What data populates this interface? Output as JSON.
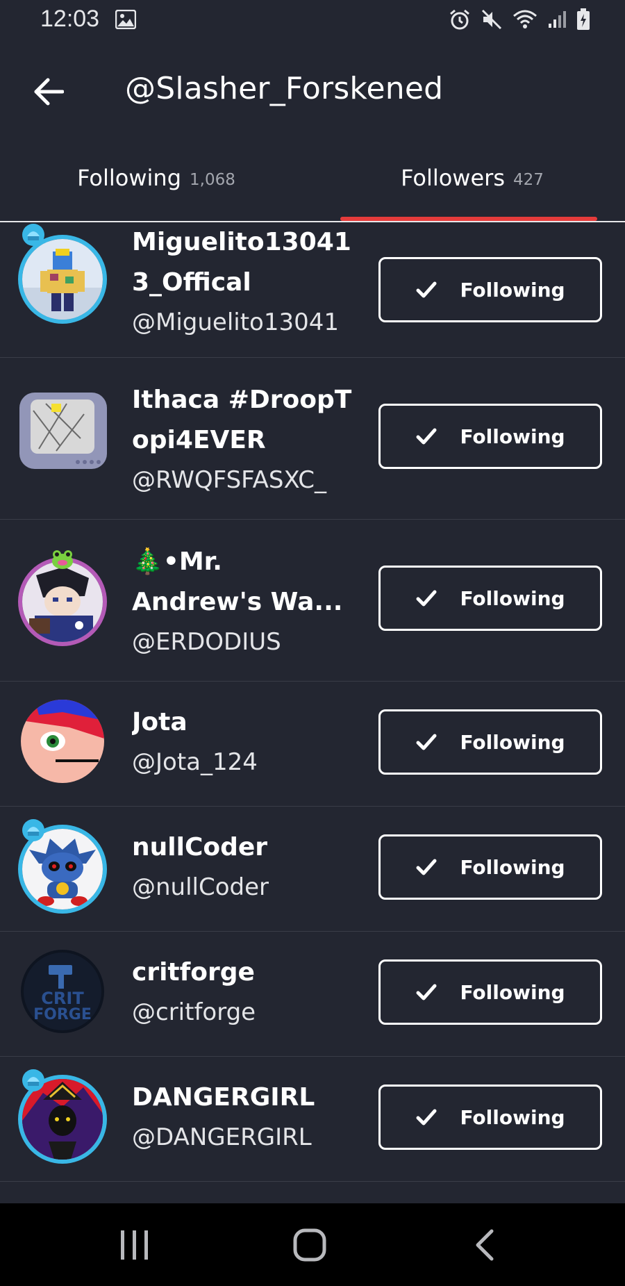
{
  "status_bar": {
    "time": "12:03"
  },
  "app_bar": {
    "title": "@Slasher_Forskened"
  },
  "tabs": [
    {
      "label": "Following",
      "count": "1,068",
      "active": false
    },
    {
      "label": "Followers",
      "count": "427",
      "active": true
    }
  ],
  "accent_color": "#e53b3b",
  "background_color": "#232631",
  "followers": [
    {
      "display_name_line1": "Miguelito13041",
      "display_name_line2": "3_Offical",
      "username": "@Miguelito13041",
      "button_label": "Following",
      "avatar_icon": "roblox-avatar-icon"
    },
    {
      "display_name_line1": "Ithaca #DroopT",
      "display_name_line2": "opi4EVER",
      "username": "@RWQFSFASXC_",
      "button_label": "Following",
      "avatar_icon": "tv-avatar-icon"
    },
    {
      "display_name_line1": "🎄•Mr.",
      "display_name_line2": "Andrew's Wa...",
      "username": "@ERDODIUS",
      "button_label": "Following",
      "avatar_icon": "anime-avatar-icon"
    },
    {
      "display_name_line1": "Jota",
      "username": "@Jota_124",
      "button_label": "Following",
      "avatar_icon": "cartoon-face-avatar-icon"
    },
    {
      "display_name_line1": "nullCoder",
      "username": "@nullCoder",
      "button_label": "Following",
      "avatar_icon": "robot-hedgehog-avatar-icon"
    },
    {
      "display_name_line1": "critforge",
      "username": "@critforge",
      "button_label": "Following",
      "avatar_icon": "crit-forge-logo-icon"
    },
    {
      "display_name_line1": "DANGERGIRL",
      "username": "@DANGERGIRL",
      "button_label": "Following",
      "avatar_icon": "dark-character-avatar-icon"
    }
  ]
}
